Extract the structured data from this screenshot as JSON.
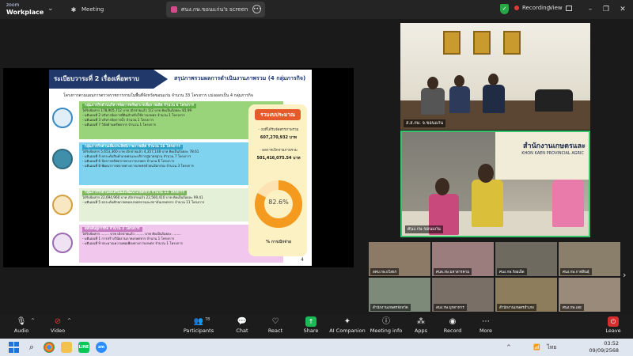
{
  "app": {
    "brand_line1": "zoom",
    "brand_line2": "Workplace"
  },
  "tabs": [
    {
      "label": "Meeting"
    },
    {
      "label": "ศนง.กษ.ขอนแก่น's screen"
    }
  ],
  "status": {
    "recording": "Recording",
    "view": "View"
  },
  "slide": {
    "title": "ระเบียบวาระที่ 2 เรื่องเพื่อทราบ",
    "subtitle": "สรุปภาพรวมผลการดำเนินงานภาพรวม (4 กลุ่มภารกิจ)",
    "description": "โครงการตามแผนการตรวจราชการกรมในพื้นที่จังหวัดขอนแก่น จำนวน 33 โครงการ แบ่งออกเป็น 4 กลุ่มภารกิจ",
    "blocks": [
      {
        "head": "กลุ่มภารกิจด้านบริหารจัดการทรัพยากรเพื่อการผลิต จำนวน 6 โครงการ",
        "lines": [
          "ได้รับจัดสรร 178,905,712 บาท เบิกจ่ายแล้ว 1/2 บาท คิดเป็นร้อยละ 81.99",
          "- มติแผนที่ 2 บริหารจัดการที่ดินสำหรับใช้การเกษตร จำนวน 1 โครงการ",
          "- มติแผนที่ 3 บริหารจัดการน้ำ จำนวน 1 โครงการ",
          "- มติแผนที่ 7 วิจัยด้านทรัพยากร จำนวน 1 โครงการ"
        ]
      },
      {
        "head": "กลุ่มภารกิจด้านเพิ่มประสิทธิภาพการผลิต จำนวน 16 โครงการ",
        "lines": [
          "ได้รับจัดสรร 5,653,360 บาท เบิกจ่ายแล้ว 4,357,148 บาท คิดเป็นร้อยละ 78.61",
          "- มติแผนที่ 4 ยกระดับสินค้าเกษตรและบริการสู่มาตรฐาน จำนวน 7 โครงการ",
          "- มติแผนที่ 6 จัดการทรัพยากรทางการเกษตร จำนวน 6 โครงการ",
          "- มติแผนที่ 8 พัฒนาการตลาดทางการเกษตรด้วยนวัตกรรม จำนวน 3 โครงการ"
        ]
      },
      {
        "head": "กลุ่มภารกิจด้านส่งเสริมและพัฒนาเกษตรกร จำนวน 11 โครงการ",
        "lines": [
          "ได้รับจัดสรร 22,694,960 บาท เบิกจ่ายแล้ว 22,560,410 บาท คิดเป็นร้อยละ 99.41",
          "- มติแผนที่ 5 ยกระดับศักยภาพของเกษตรกรและสถาบันเกษตรกร จำนวน 11 โครงการ"
        ]
      },
      {
        "head": "ผลักดันสู่ภารกิจ จำนวน 2 โครงการ",
        "lines": [
          "ได้รับจัดสรร ........ บาท เบิกจ่ายแล้ว ........ บาท คิดเป็นร้อยละ ........",
          "- มติแผนที่ 1 การสร้างวินัยงานภาคเกษตรกร จำนวน 1 โครงการ",
          "- มติแผนที่ 9 ประมาณความพอเพียงทางการเกษตร จำนวน 1 โครงการ"
        ]
      }
    ],
    "budget": {
      "title": "รวมงบประมาณ",
      "allocated_label": "- งบที่ได้รับจัดสรรภาพรวม",
      "allocated_value": "607,270,932 บาท",
      "spent_label": "- ผลการเบิกจ่ายภาพรวม",
      "spent_value": "501,416,075.54 บาท",
      "percent": 82.6,
      "percent_label": "82.6%",
      "caption": "% การเบิกจ่าย"
    },
    "page": "4"
  },
  "videos": {
    "top_name": "ส.ส.กษ. จ.ขอนแก่น",
    "main_name": "ศนง.กษ.ขอนแก่น",
    "sign_line1": "สำนักงานเกษตรและ",
    "sign_line2": "KHON KAEN PROVINCIAL AGRIC"
  },
  "gallery": [
    "สคบ.กษ.ยโสธร",
    "ศนพ.กษ.มหาสารคาม",
    "ศนง.กษ.ร้อยเอ็ด",
    "ศนง.กษ.กาฬสินธุ์",
    "สำนักงานเกษตรจังหวัด",
    "สนง.กษ.มุกดาหาร",
    "สำนักงานเกษตรอำเภอ",
    "ศนง.กษ.เลย"
  ],
  "toolbar": {
    "audio": "Audio",
    "video": "Video",
    "participants": "Participants",
    "participant_count": "78",
    "chat": "Chat",
    "react": "React",
    "share": "Share",
    "ai": "AI Companion",
    "info": "Meeting info",
    "apps": "Apps",
    "record": "Record",
    "more": "More",
    "leave": "Leave"
  },
  "taskbar": {
    "lang": "ไทย",
    "time": "03:52",
    "date": "09/09/2568"
  },
  "colors": {
    "accent_green": "#36c56a",
    "record_red": "#e53935",
    "slide_navy": "#20396a",
    "donut_orange": "#f39a1f"
  }
}
